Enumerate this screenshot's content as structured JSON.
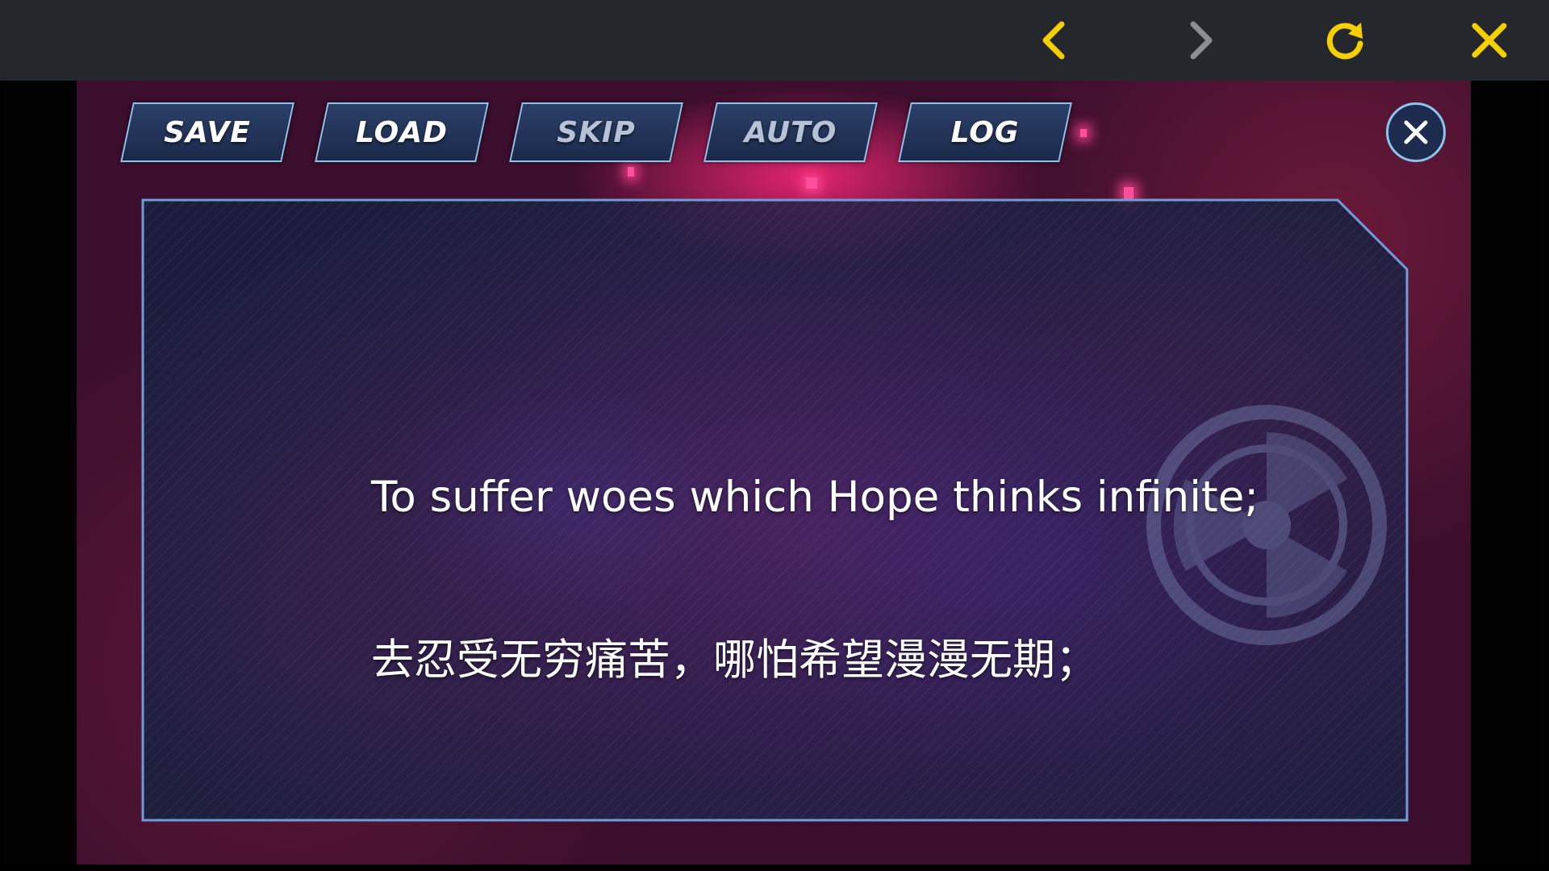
{
  "top_bar": {
    "back_icon": "chevron-left-icon",
    "forward_icon": "chevron-right-icon",
    "reload_icon": "reload-icon",
    "close_icon": "close-icon",
    "icon_color": "#f5d000",
    "forward_icon_color": "#8a8d92"
  },
  "menu": {
    "buttons": [
      {
        "label": "SAVE"
      },
      {
        "label": "LOAD"
      },
      {
        "label": "SKIP"
      },
      {
        "label": "AUTO"
      },
      {
        "label": "LOG"
      }
    ],
    "close_icon": "close-icon"
  },
  "dialog": {
    "line_en": "To suffer woes which Hope thinks infinite;",
    "line_zh": "去忍受无穷痛苦，哪怕希望漫漫无期；"
  },
  "colors": {
    "button_border": "#8cc4ec",
    "panel_fill": "#1c2447",
    "accent_pink": "#ff2e78"
  }
}
